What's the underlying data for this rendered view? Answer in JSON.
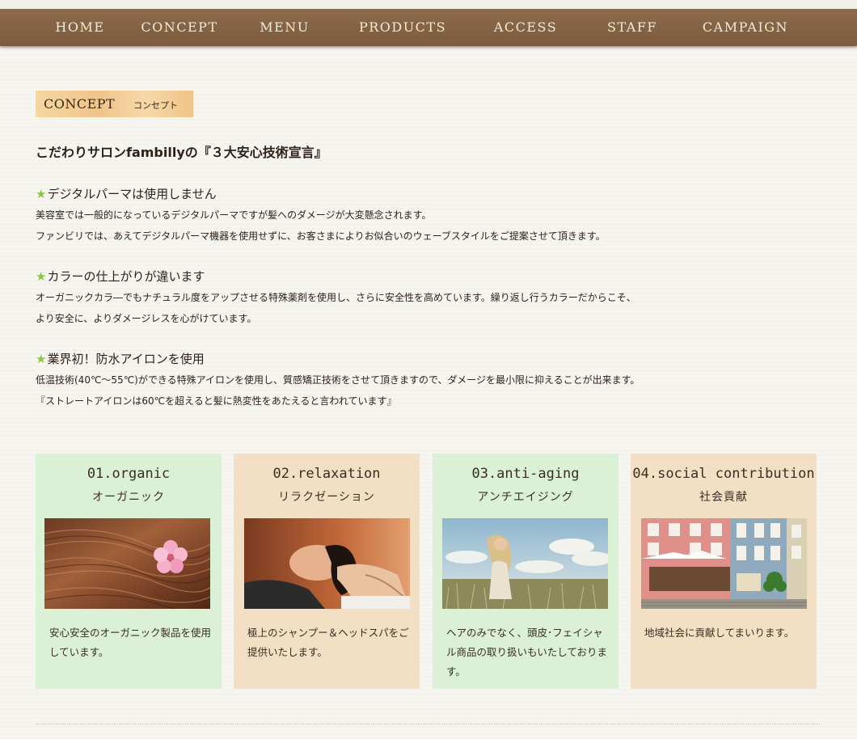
{
  "nav": {
    "items": [
      "HOME",
      "CONCEPT",
      "MENU",
      "PRODUCTS",
      "ACCESS",
      "STAFF",
      "CAMPAIGN"
    ]
  },
  "section": {
    "title_en": "CONCEPT",
    "title_jp": "コンセプト"
  },
  "headline": "こだわりサロンfambillyの『３大安心技術宣言』",
  "points": [
    {
      "icon": "star-icon",
      "title": "デジタルパーマは使用しません",
      "lines": [
        "美容室では一般的になっているデジタルパーマですが髪へのダメージが大変懸念されます。",
        "ファンビリでは、あえてデジタルパーマ機器を使用せずに、お客さまによりお似合いのウェーブスタイルをご提案させて頂きます。"
      ]
    },
    {
      "icon": "star-icon",
      "title": "カラーの仕上がりが違います",
      "lines": [
        "オーガニックカラ―でもナチュラル度をアップさせる特殊薬剤を使用し、さらに安全性を高めています。繰り返し行うカラーだからこそ、",
        "より安全に、よりダメージレスを心がけています。"
      ]
    },
    {
      "icon": "star-icon",
      "title": "業界初！防水アイロンを使用",
      "lines": [
        "低温技術(40℃～55℃)ができる特殊アイロンを使用し、質感矯正技術をさせて頂きますので、ダメージを最小限に抑えることが出来ます。",
        "『ストレートアイロンは60℃を超えると髪に熱変性をあたえると言われています』"
      ]
    }
  ],
  "cards": [
    {
      "title_en": "01.organic",
      "title_jp": "オーガニック",
      "image": "hair-with-flower-photo",
      "text": "安心安全のオーガニック製品を使用しています。",
      "bg": "#dbf1d5"
    },
    {
      "title_en": "02.relaxation",
      "title_jp": "リラクゼーション",
      "image": "head-spa-photo",
      "text": "極上のシャンプー＆ヘッドスパをご提供いたします。",
      "bg": "#f3dfc4"
    },
    {
      "title_en": "03.anti-aging",
      "title_jp": "アンチエイジング",
      "image": "woman-in-field-photo",
      "text": "ヘアのみでなく、頭皮･フェイシャル商品の取り扱いもいたしております。",
      "bg": "#dbf1d5"
    },
    {
      "title_en": "04.social contribution",
      "title_jp": "社会貢献",
      "image": "town-street-photo",
      "text": "地域社会に貢献してまいります。",
      "bg": "#f3dfc4"
    }
  ],
  "colors": {
    "nav_bg": "#85644a",
    "star": "#8cc63f",
    "card_green": "#dbf1d5",
    "card_beige": "#f3dfc4"
  }
}
